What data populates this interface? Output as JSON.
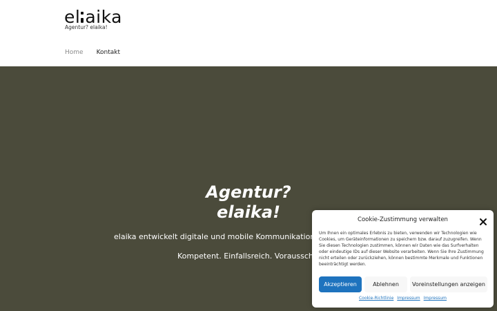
{
  "header": {
    "logo_text_left": "el",
    "logo_text_right": "aika",
    "tagline": "Agentur? elaika!",
    "nav": [
      {
        "label": "Home"
      },
      {
        "label": "Kontakt"
      }
    ]
  },
  "hero": {
    "title_line1": "Agentur?",
    "title_line2": "elaika!",
    "subtitle": "elaika entwickelt digitale und mobile Kommunikations- und",
    "subtitle2": "Kompetent. Einfallsreich. Vorausschauen",
    "background_color": "#4b4b3b"
  },
  "cookie_banner": {
    "title": "Cookie-Zustimmung verwalten",
    "close_icon": "close-icon",
    "text": "Um Ihnen ein optimales Erlebnis zu bieten, verwenden wir Technologien wie Cookies, um Geräteinformationen zu speichern bzw. darauf zuzugreifen. Wenn Sie diesen Technologien zustimmen, können wir Daten wie das Surfverhalten oder eindeutige IDs auf dieser Website verarbeiten. Wenn Sie Ihre Zustimmung nicht erteilen oder zurückziehen, können bestimmte Merkmale und Funktionen beeinträchtigt werden.",
    "accept_label": "Akzeptieren",
    "decline_label": "Ablehnen",
    "preferences_label": "Voreinstellungen anzeigen",
    "links": [
      "Cookie-Richtlinie",
      "Impressum",
      "Impressum"
    ],
    "accent_color": "#1e73be"
  }
}
